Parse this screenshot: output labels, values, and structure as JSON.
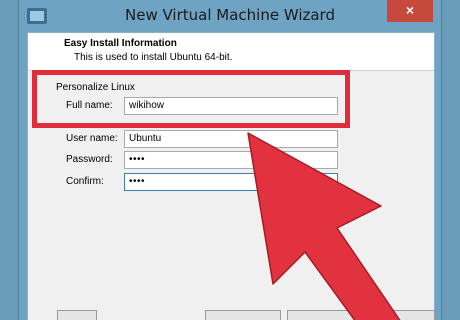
{
  "window": {
    "title": "New Virtual Machine Wizard",
    "close_symbol": "×"
  },
  "header": {
    "title": "Easy Install Information",
    "subtitle": "This is used to install Ubuntu 64-bit."
  },
  "personalize": {
    "group_label": "Personalize Linux",
    "full_name_label": "Full name:",
    "full_name_value": "wikihow",
    "user_name_label": "User name:",
    "user_name_value": "Ubuntu",
    "password_label": "Password:",
    "password_value": "••••",
    "confirm_label": "Confirm:",
    "confirm_value": "••••"
  },
  "colors": {
    "highlight": "#e02d3b",
    "arrow_fill": "#e2323f"
  },
  "icons": {
    "app": "vm-wizard-icon",
    "arrow": "annotation-arrow"
  }
}
